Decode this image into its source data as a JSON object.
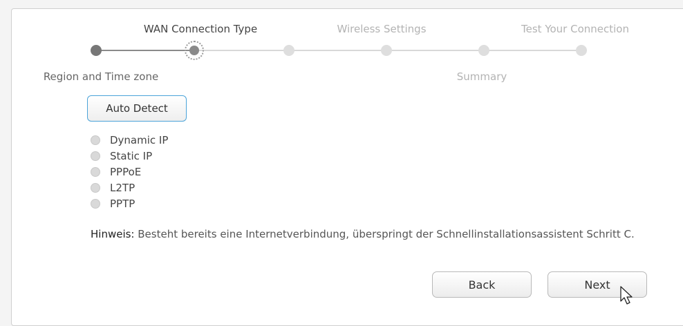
{
  "wizard": {
    "steps": [
      {
        "label": "Region and Time zone",
        "state": "done"
      },
      {
        "label": "WAN Connection Type",
        "state": "current"
      },
      {
        "label": "Wireless Settings",
        "state": "pending"
      },
      {
        "label": "Summary",
        "state": "pending"
      },
      {
        "label": "Test Your Connection",
        "state": "pending"
      },
      {
        "label": "",
        "state": "pending"
      }
    ]
  },
  "detect": {
    "auto_detect_label": "Auto Detect"
  },
  "connection_types": [
    {
      "label": "Dynamic IP"
    },
    {
      "label": "Static IP"
    },
    {
      "label": "PPPoE"
    },
    {
      "label": "L2TP"
    },
    {
      "label": "PPTP"
    }
  ],
  "note": {
    "prefix": "Hinweis:",
    "text": " Besteht bereits eine Internetverbindung, überspringt der Schnellinstallationsassistent Schritt C."
  },
  "buttons": {
    "back_label": "Back",
    "next_label": "Next"
  },
  "icons": {
    "cursor": "mouse-pointer-icon"
  },
  "colors": {
    "accent_border": "#4aa3d9",
    "done_dot": "#777777",
    "pending_dot": "#dedede"
  }
}
